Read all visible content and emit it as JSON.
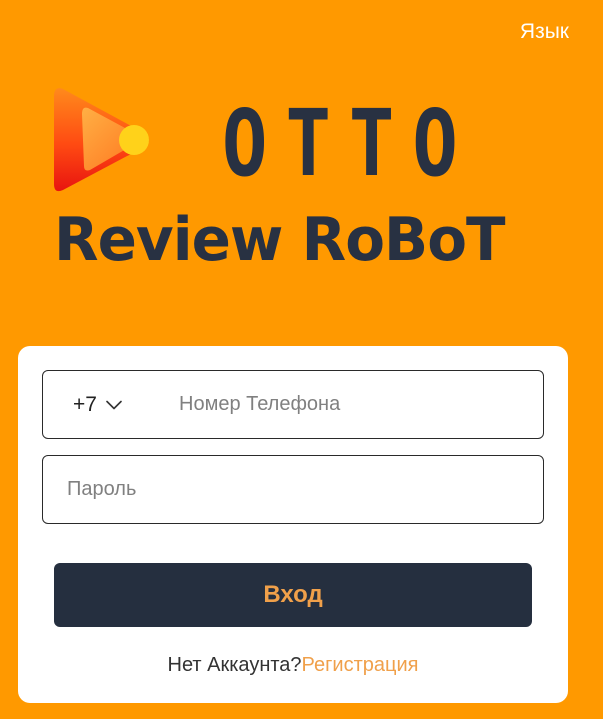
{
  "header": {
    "language_label": "Язык"
  },
  "logo": {
    "title": "OTTO",
    "subtitle": "Review RoBoT"
  },
  "form": {
    "country_code": "+7",
    "phone_placeholder": "Номер Телефона",
    "password_placeholder": "Пароль",
    "login_label": "Вход",
    "no_account_text": "Нет Аккаунта?",
    "register_label": "Регистрация"
  },
  "colors": {
    "background": "#FF9900",
    "button": "#252F3F",
    "accent": "#F0A04A",
    "logo_text": "#283142"
  },
  "icons": {
    "country_dropdown": "chevron-down-icon",
    "logo": "play-icon"
  }
}
